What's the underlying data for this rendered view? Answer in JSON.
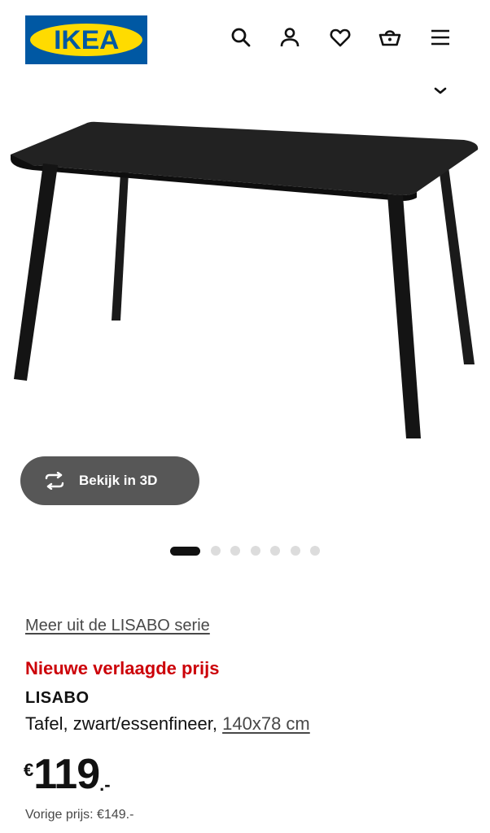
{
  "header": {
    "logo_text": "IKEA",
    "icons": [
      "search-icon",
      "user-icon",
      "heart-icon",
      "basket-icon",
      "menu-icon"
    ]
  },
  "gallery": {
    "view_3d_label": "Bekijk in 3D",
    "dot_count": 7,
    "active_dot": 1
  },
  "product": {
    "series_link": "Meer uit de LISABO serie",
    "promo_label": "Nieuwe verlaagde prijs",
    "name": "LISABO",
    "description": "Tafel, zwart/essenfineer, ",
    "size": "140x78 cm",
    "price": {
      "currency": "€",
      "integer": "119",
      "decimal": ".-"
    },
    "previous_price": "Vorige prijs: €149.-"
  },
  "colors": {
    "ikea_blue": "#0058a3",
    "ikea_yellow": "#ffdb00",
    "promo_red": "#cc0008",
    "button_gray": "#575757"
  }
}
